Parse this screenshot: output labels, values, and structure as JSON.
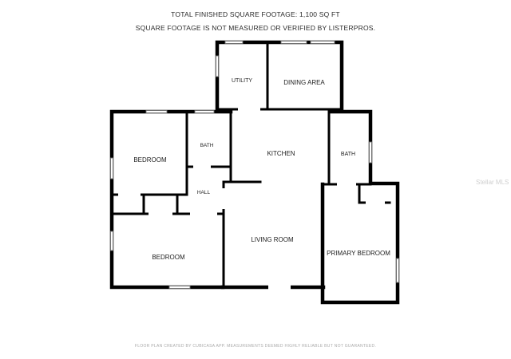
{
  "header": {
    "line1": "TOTAL FINISHED SQUARE FOOTAGE: 1,100 SQ FT",
    "line2": "SQUARE FOOTAGE IS NOT MEASURED OR VERIFIED BY LISTERPROS."
  },
  "rooms": {
    "utility": "UTILITY",
    "dining_area": "DINING AREA",
    "bedroom_top": "BEDROOM",
    "bath_left": "BATH",
    "kitchen": "KITCHEN",
    "bath_right": "BATH",
    "hall": "HALL",
    "living_room": "LIVING ROOM",
    "primary_bedroom": "PRIMARY BEDROOM",
    "bedroom_bottom": "BEDROOM"
  },
  "footer": "FLOOR PLAN CREATED BY CUBICASA APP. MEASUREMENTS DEEMED HIGHLY RELIABLE BUT NOT GUARANTEED.",
  "watermark": "Stellar MLS"
}
